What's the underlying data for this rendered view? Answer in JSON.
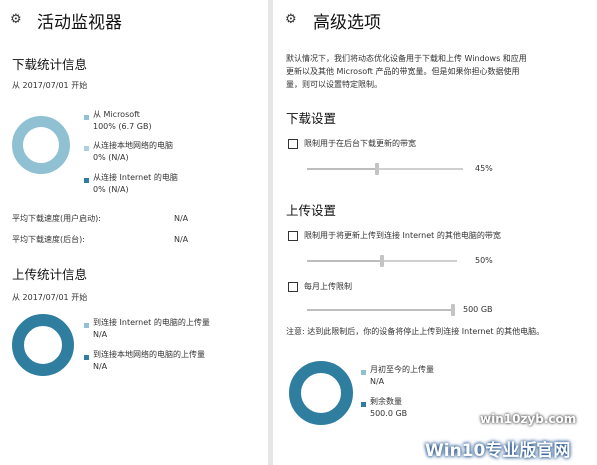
{
  "activity_monitor": {
    "title": "活动监视器",
    "download_stats": {
      "heading": "下载统计信息",
      "since": "从 2017/07/01 开始",
      "legend": [
        {
          "label": "从 Microsoft",
          "value": "100% (6.7 GB)",
          "color": "#8fc1d3",
          "fraction": 1.0
        },
        {
          "label": "从连接本地网络的电脑",
          "value": "0% (N/A)",
          "color": "#a9cfe0",
          "fraction": 0.0
        },
        {
          "label": "从连接 Internet 的电脑",
          "value": "0% (N/A)",
          "color": "#2f7ea0",
          "fraction": 0.0
        }
      ],
      "speed_user_label": "平均下载速度(用户启动):",
      "speed_user_value": "N/A",
      "speed_bg_label": "平均下载速度(后台):",
      "speed_bg_value": "N/A"
    },
    "upload_stats": {
      "heading": "上传统计信息",
      "since": "从 2017/07/01 开始",
      "legend": [
        {
          "label": "到连接 Internet 的电脑的上传量",
          "value": "N/A",
          "color": "#8fc1d3"
        },
        {
          "label": "到连接本地网络的电脑的上传量",
          "value": "N/A",
          "color": "#2f7ea0"
        }
      ]
    }
  },
  "advanced_options": {
    "title": "高级选项",
    "description": [
      "默认情况下，我们将动态优化设备用于下载和上传 Windows 和应用",
      "更新以及其他 Microsoft 产品的带宽量。但是如果你担心数据使用",
      "量，则可以设置特定限制。"
    ],
    "download_settings": {
      "heading": "下载设置",
      "checkbox_label": "限制用于在后台下载更新的带宽",
      "checked": false,
      "slider_percent": 45,
      "slider_value": "45%"
    },
    "upload_settings": {
      "heading": "上传设置",
      "bandwidth_checkbox_label": "限制用于将更新上传到连接 Internet 的其他电脑的带宽",
      "bandwidth_checked": false,
      "bandwidth_slider_percent": 50,
      "bandwidth_slider_value": "50%",
      "monthly_checkbox_label": "每月上传限制",
      "monthly_checked": false,
      "monthly_slider_fraction": 1.0,
      "monthly_slider_value": "500 GB",
      "note": "注意: 达到此限制后，你的设备将停止上传到连接 Internet 的其他电脑。",
      "legend": [
        {
          "label": "月初至今的上传量",
          "value": "N/A",
          "color": "#8fc1d3"
        },
        {
          "label": "剩余数量",
          "value": "500.0 GB",
          "color": "#2f7ea0"
        }
      ]
    }
  },
  "watermark": {
    "url": "win10zyb.com",
    "brand": "Win10专业版官网"
  }
}
